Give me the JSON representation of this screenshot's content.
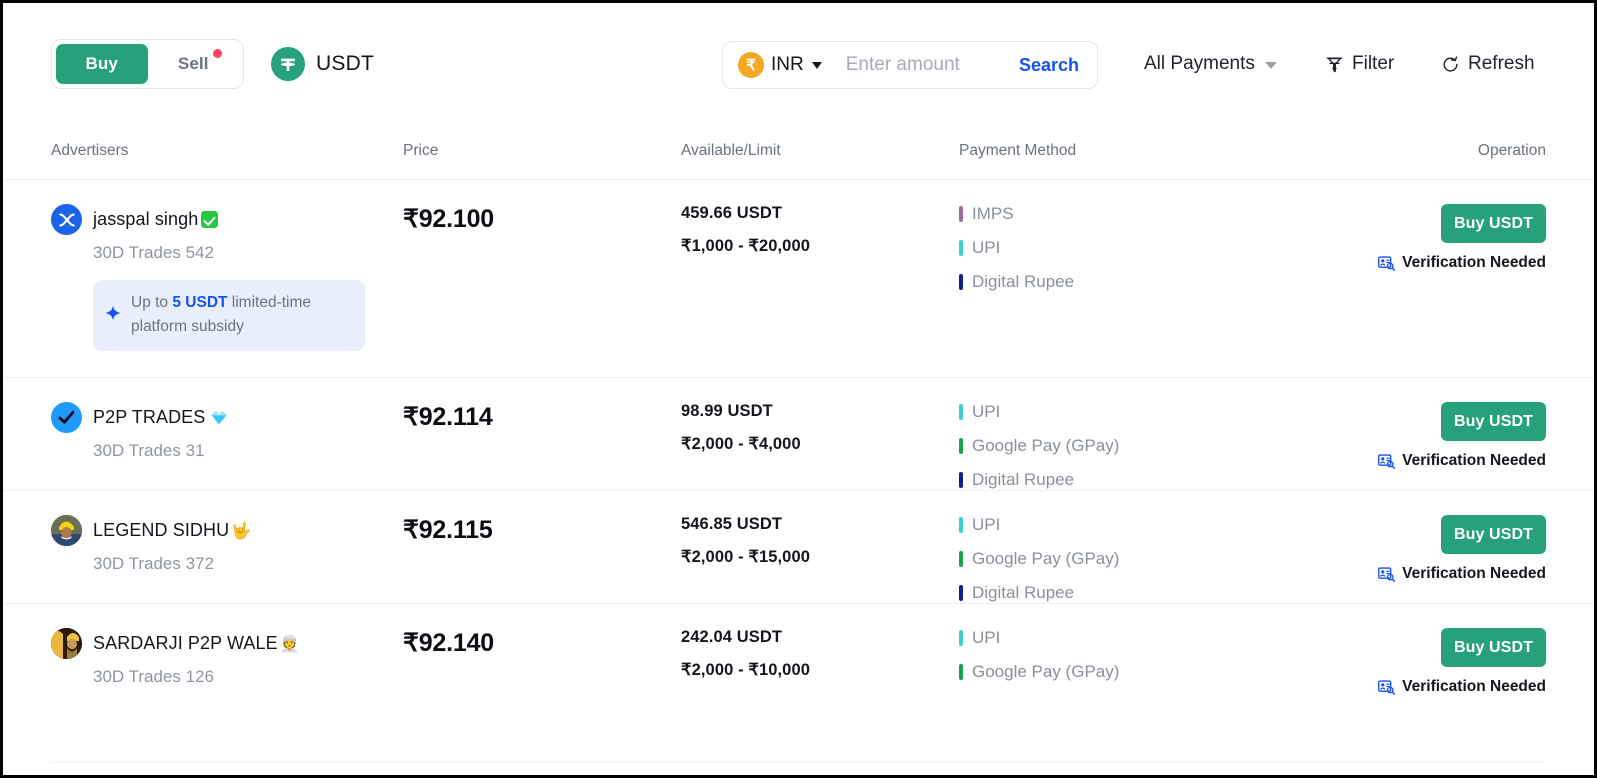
{
  "toolbar": {
    "buy_label": "Buy",
    "sell_label": "Sell",
    "coin_label": "USDT",
    "coin_icon": "tether-icon",
    "all_payments_label": "All Payments",
    "filter_label": "Filter",
    "refresh_label": "Refresh"
  },
  "search": {
    "currency_code": "INR",
    "currency_symbol": "₹",
    "amount_value": "",
    "amount_placeholder": "Enter amount",
    "search_label": "Search"
  },
  "table": {
    "headers": {
      "advertisers": "Advertisers",
      "price": "Price",
      "available": "Available/Limit",
      "payment": "Payment Method",
      "operation": "Operation"
    },
    "rows": [
      {
        "name": "jasspal singh",
        "name_badge": "green-verified-check",
        "name_emoji": "",
        "avatar_style": "blue-x-avatar",
        "trades": "30D Trades 542",
        "subsidy": {
          "prefix": "Up to ",
          "highlight": "5 USDT",
          "suffix": " limited-time platform subsidy"
        },
        "price": "₹92.100",
        "available": "459.66 USDT",
        "limit": "₹1,000 - ₹20,000",
        "payments": [
          {
            "label": "IMPS",
            "color": "#9d6ba0"
          },
          {
            "label": "UPI",
            "color": "#3dd2cf"
          },
          {
            "label": "Digital Rupee",
            "color": "#101e8f"
          }
        ],
        "buy_label": "Buy USDT",
        "verification": "Verification Needed"
      },
      {
        "name": "P2P TRADES",
        "name_badge": "",
        "name_emoji": "gem-emoji",
        "avatar_style": "blue-check-avatar",
        "trades": "30D Trades 31",
        "subsidy": null,
        "price": "₹92.114",
        "available": "98.99 USDT",
        "limit": "₹2,000 - ₹4,000",
        "payments": [
          {
            "label": "UPI",
            "color": "#3dd2cf"
          },
          {
            "label": "Google Pay (GPay)",
            "color": "#16a34a"
          },
          {
            "label": "Digital Rupee",
            "color": "#101e8f"
          }
        ],
        "buy_label": "Buy USDT",
        "verification": "Verification Needed"
      },
      {
        "name": "LEGEND SIDHU",
        "name_badge": "",
        "name_emoji": "🤟",
        "avatar_style": "photo-turban-avatar",
        "trades": "30D Trades 372",
        "subsidy": null,
        "price": "₹92.115",
        "available": "546.85 USDT",
        "limit": "₹2,000 - ₹15,000",
        "payments": [
          {
            "label": "UPI",
            "color": "#3dd2cf"
          },
          {
            "label": "Google Pay (GPay)",
            "color": "#16a34a"
          },
          {
            "label": "Digital Rupee",
            "color": "#101e8f"
          }
        ],
        "buy_label": "Buy USDT",
        "verification": "Verification Needed"
      },
      {
        "name": "SARDARJI P2P WALE",
        "name_badge": "",
        "name_emoji": "👳",
        "avatar_style": "photo-sardar-avatar",
        "trades": "30D Trades 126",
        "subsidy": null,
        "price": "₹92.140",
        "available": "242.04 USDT",
        "limit": "₹2,000 - ₹10,000",
        "payments": [
          {
            "label": "UPI",
            "color": "#3dd2cf"
          },
          {
            "label": "Google Pay (GPay)",
            "color": "#16a34a"
          }
        ],
        "buy_label": "Buy USDT",
        "verification": "Verification Needed"
      }
    ]
  },
  "colors": {
    "brand_green": "#26a17b",
    "link_blue": "#1652f0",
    "alert_red": "#f6465d",
    "subsidy_bg": "#e8eefc"
  }
}
